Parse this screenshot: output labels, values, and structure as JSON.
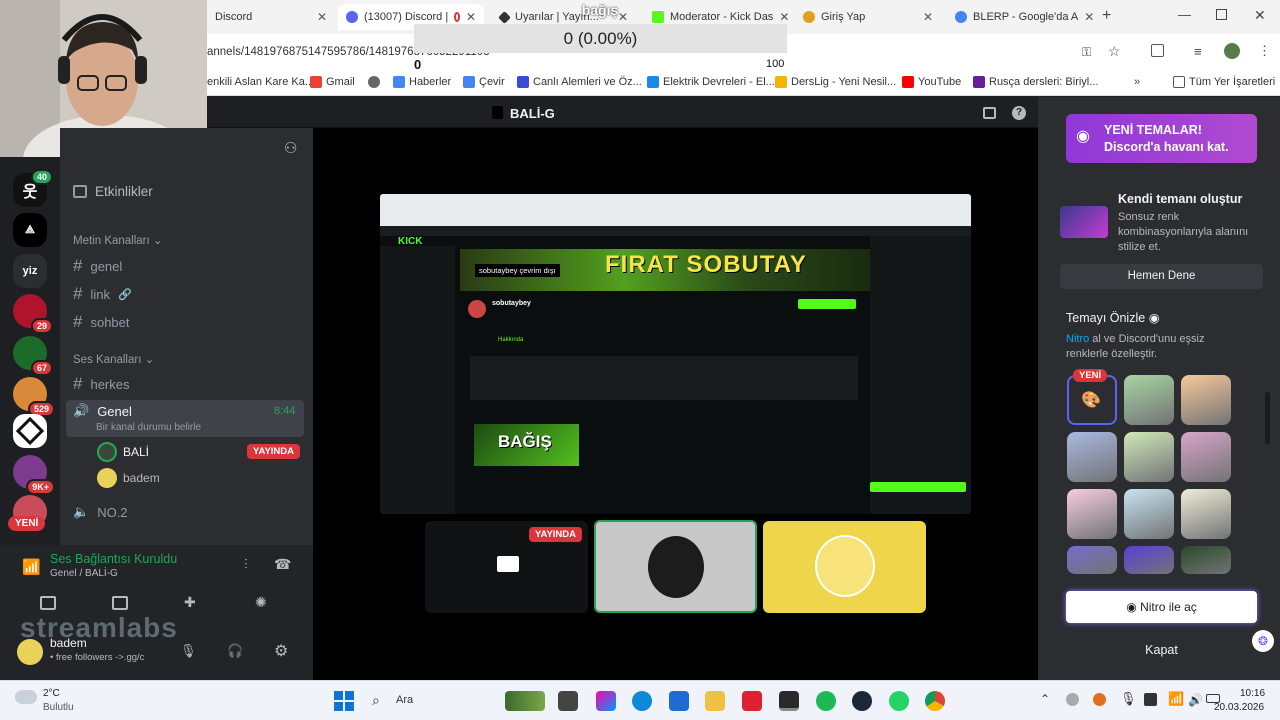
{
  "browser": {
    "tabs": [
      {
        "label": "Discord",
        "active": false
      },
      {
        "label": "(13007) Discord |",
        "active": true
      },
      {
        "label": "Uyarılar | Yayın...",
        "active": false
      },
      {
        "label": "Moderator - Kick Das",
        "active": false
      },
      {
        "label": "Giriş Yap",
        "active": false
      },
      {
        "label": "BLERP - Google'da A",
        "active": false
      }
    ],
    "url": "annels/1481976875147595786/1481976876052291103",
    "bookmarks": [
      "enkili Aslan Kare Ka...",
      "Gmail",
      "Haberler",
      "Çevir",
      "Canlı Alemleri ve Öz...",
      "Elektrik Devreleri - El...",
      "DersLig - Yeni Nesil...",
      "YouTube",
      "Rusça dersleri: Biriyl...",
      "Tüm Yer İşaretleri"
    ]
  },
  "overlay": {
    "title": "bağış",
    "value": "0 (0.00%)",
    "min": "0",
    "max": "100"
  },
  "discord": {
    "channel_title": "BALİ-G",
    "servers": [
      {
        "badge": "40"
      },
      {
        "badge": ""
      },
      {
        "label": "yiz",
        "badge": ""
      },
      {
        "badge": "29"
      },
      {
        "badge": "67"
      },
      {
        "badge": "529"
      },
      {
        "badge": ""
      },
      {
        "badge": "9K+"
      },
      {
        "badge": ""
      }
    ],
    "new_label": "YENİ",
    "events": "Etkinlikler",
    "text_category": "Metin Kanalları",
    "text_channels": [
      "genel",
      "link",
      "sohbet"
    ],
    "voice_category": "Ses Kanalları",
    "voice_channels": {
      "herkes": "herkes",
      "active": "Genel",
      "active_time": "8:44",
      "status": "Bir kanal durumu belirle",
      "last": "NO.2"
    },
    "members": [
      {
        "name": "BALİ",
        "live": "YAYINDA"
      },
      {
        "name": "badem",
        "live": ""
      }
    ],
    "voice_status": {
      "title": "Ses Bağlantısı Kuruldu",
      "sub": "Genel / BALİ-G"
    },
    "user": {
      "name": "badem",
      "sub": "• free followers ->.gg/c"
    },
    "watermark": "streamlabs",
    "stage_live": "YAYINDA"
  },
  "kick": {
    "banner": "FIRAT SOBUTAY",
    "offline": "sobutaybey çevrim dışı",
    "channel": "sobutaybey",
    "about_tab": "Hakkında",
    "donate": "BAĞIŞ"
  },
  "rpanel": {
    "promo_title": "YENİ TEMALAR!",
    "promo_sub": "Discord'a havanı kat.",
    "create_title": "Kendi temanı oluştur",
    "create_sub": "Sonsuz renk kombinasyonlarıyla alanını stilize et.",
    "try_button": "Hemen Dene",
    "preview_title": "Temayı Önizle",
    "preview_sub_1": "Nitro",
    "preview_sub_2": " al ve Discord'unu eşsiz renklerle özelleştir.",
    "new_badge": "YENİ",
    "nitro_button": "Nitro ile aç",
    "close": "Kapat",
    "swatches": [
      "#2b2d31",
      "#a8d5a2",
      "#f7c99a",
      "#a9b9e0",
      "#cfe8b8",
      "#d8a5c8",
      "#f6cde0",
      "#c8e4f0",
      "#efeed8",
      "#7a6bc9",
      "#5b3fd6",
      "#2a4a2a"
    ]
  },
  "taskbar": {
    "weather_temp": "2°C",
    "weather_desc": "Bulutlu",
    "search": "Ara",
    "time": "10:16",
    "date": "20.03.2026"
  }
}
